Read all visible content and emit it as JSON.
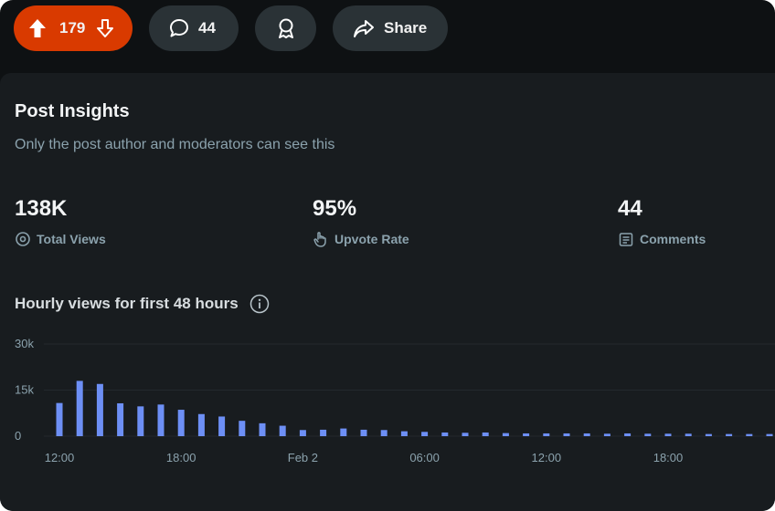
{
  "post_actions": {
    "upvotes": "179",
    "comments": "44",
    "share_label": "Share"
  },
  "insights": {
    "title": "Post Insights",
    "subtitle": "Only the post author and moderators can see this",
    "stats": [
      {
        "value": "138K",
        "label": "Total Views",
        "icon": "views-icon"
      },
      {
        "value": "95%",
        "label": "Upvote Rate",
        "icon": "hand-pointer-icon"
      },
      {
        "value": "44",
        "label": "Comments",
        "icon": "comments-icon"
      }
    ],
    "chart_title": "Hourly views for first 48 hours"
  },
  "colors": {
    "accent_vote": "#d93a00",
    "bar": "#6d8ff5",
    "background": "#0e1113",
    "card": "#181c1f"
  },
  "chart_data": {
    "type": "bar",
    "title": "Hourly views for first 48 hours",
    "xlabel": "",
    "ylabel": "",
    "ylim": [
      0,
      30000
    ],
    "yticks": [
      "0",
      "15k",
      "30k"
    ],
    "xtick_labels": [
      "12:00",
      "18:00",
      "Feb 2",
      "06:00",
      "12:00",
      "18:00"
    ],
    "xtick_hour_index": [
      0,
      6,
      12,
      18,
      24,
      30
    ],
    "values": [
      10800,
      18000,
      17000,
      10700,
      9700,
      10300,
      8600,
      7200,
      6400,
      5000,
      4200,
      3400,
      2000,
      2100,
      2500,
      2100,
      2000,
      1600,
      1400,
      1200,
      1100,
      1200,
      1000,
      900,
      900,
      900,
      900,
      800,
      900,
      800,
      800,
      800,
      700,
      700,
      700,
      700,
      700
    ]
  }
}
